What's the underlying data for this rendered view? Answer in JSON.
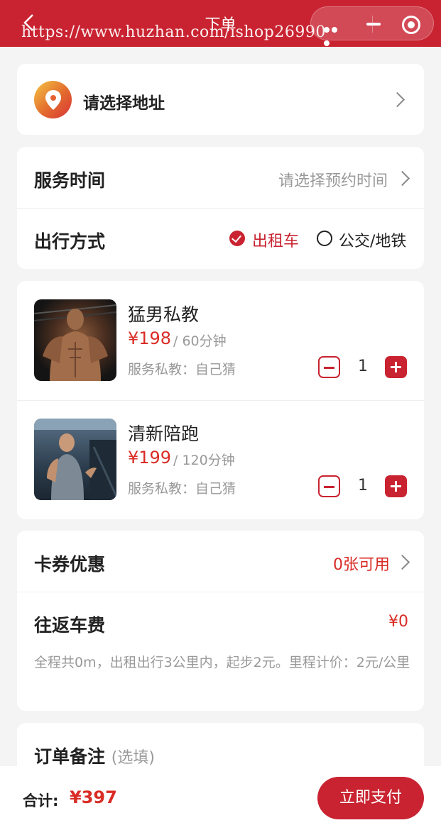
{
  "header": {
    "title": "下单",
    "watermark": "https://www.huzhan.com/ishop26990"
  },
  "address": {
    "placeholder": "请选择地址"
  },
  "service": {
    "time_label": "服务时间",
    "time_placeholder": "请选择预约时间",
    "travel_label": "出行方式",
    "travel_options": [
      {
        "label": "出租车",
        "selected": true
      },
      {
        "label": "公交/地铁",
        "selected": false
      }
    ]
  },
  "products": [
    {
      "name": "猛男私教",
      "price": "¥198",
      "duration": "/ 60分钟",
      "coach": "服务私教：自己猜",
      "quantity": "1"
    },
    {
      "name": "清新陪跑",
      "price": "¥199",
      "duration": "/ 120分钟",
      "coach": "服务私教：自己猜",
      "quantity": "1"
    }
  ],
  "fees": {
    "coupon_label": "卡券优惠",
    "coupon_value": "0张可用",
    "fare_label": "往返车费",
    "fare_value": "¥0",
    "fare_note": "全程共0m，出租出行3公里内，起步2元。里程计价：2元/公里"
  },
  "remark": {
    "label": "订单备注",
    "optional": "(选填)"
  },
  "footer": {
    "total_label": "合计:",
    "total_value": "¥397",
    "pay_label": "立即支付"
  },
  "colors": {
    "brand": "#c92331",
    "price": "#d92c25"
  }
}
